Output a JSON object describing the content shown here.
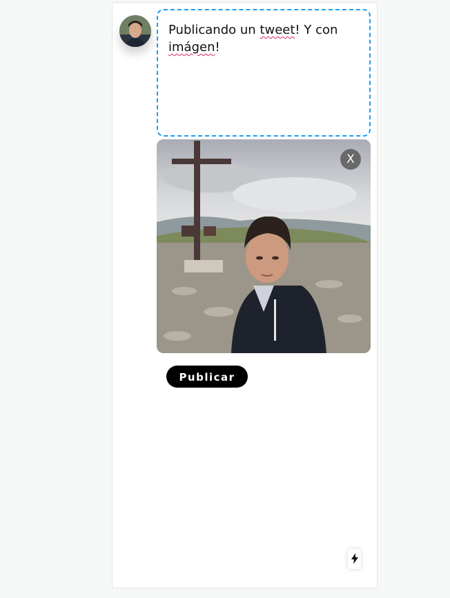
{
  "composer": {
    "text_part1": "Publicando un ",
    "text_misspelled1": "tweet",
    "text_part2": "! Y con ",
    "text_misspelled2": "imágen",
    "text_part3": "!"
  },
  "media": {
    "remove_label": "X"
  },
  "actions": {
    "publish_label": "Publicar"
  },
  "icons": {
    "avatar": "user-avatar",
    "remove": "close-icon",
    "dev_indicator": "lightning-bolt-icon"
  },
  "colors": {
    "border_accent": "#1d9bf0",
    "button_bg": "#000000",
    "spell_underline": "#e0245e"
  }
}
